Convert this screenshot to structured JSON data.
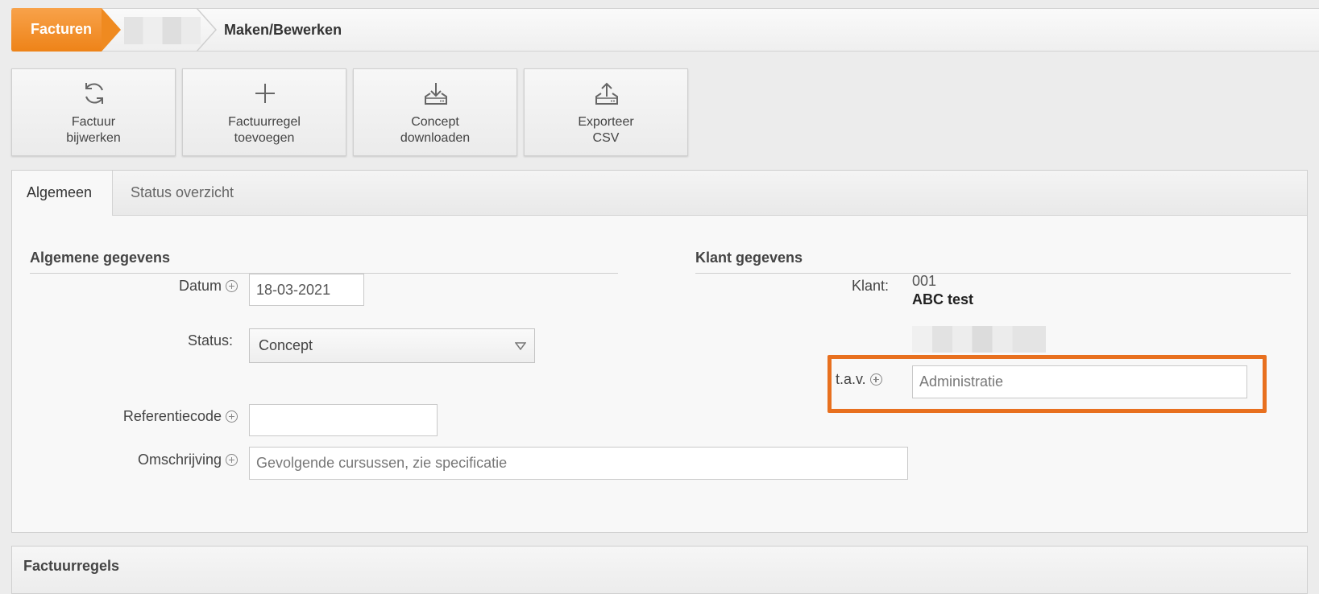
{
  "breadcrumb": {
    "first": "Facturen",
    "current": "Maken/Bewerken"
  },
  "actions": [
    {
      "line1": "Factuur",
      "line2": "bijwerken",
      "icon": "refresh-icon"
    },
    {
      "line1": "Factuurregel",
      "line2": "toevoegen",
      "icon": "plus-icon"
    },
    {
      "line1": "Concept",
      "line2": "downloaden",
      "icon": "download-icon"
    },
    {
      "line1": "Exporteer",
      "line2": "CSV",
      "icon": "upload-icon"
    }
  ],
  "tabs": {
    "active": "Algemeen",
    "inactive": "Status overzicht"
  },
  "general": {
    "title": "Algemene gegevens",
    "datum_label": "Datum",
    "datum_value": "18-03-2021",
    "status_label": "Status:",
    "status_value": "Concept",
    "referentie_label": "Referentiecode",
    "referentie_value": "",
    "omschrijving_label": "Omschrijving",
    "omschrijving_placeholder": "Gevolgende cursussen, zie specificatie"
  },
  "client": {
    "title": "Klant gegevens",
    "klant_label": "Klant:",
    "klant_number": "001",
    "klant_name": "ABC test",
    "tav_label": "t.a.v.",
    "tav_placeholder": "Administratie"
  },
  "invoice_lines": {
    "title": "Factuurregels"
  },
  "colors": {
    "accent": "#ee8318",
    "highlight": "#e8701f"
  }
}
